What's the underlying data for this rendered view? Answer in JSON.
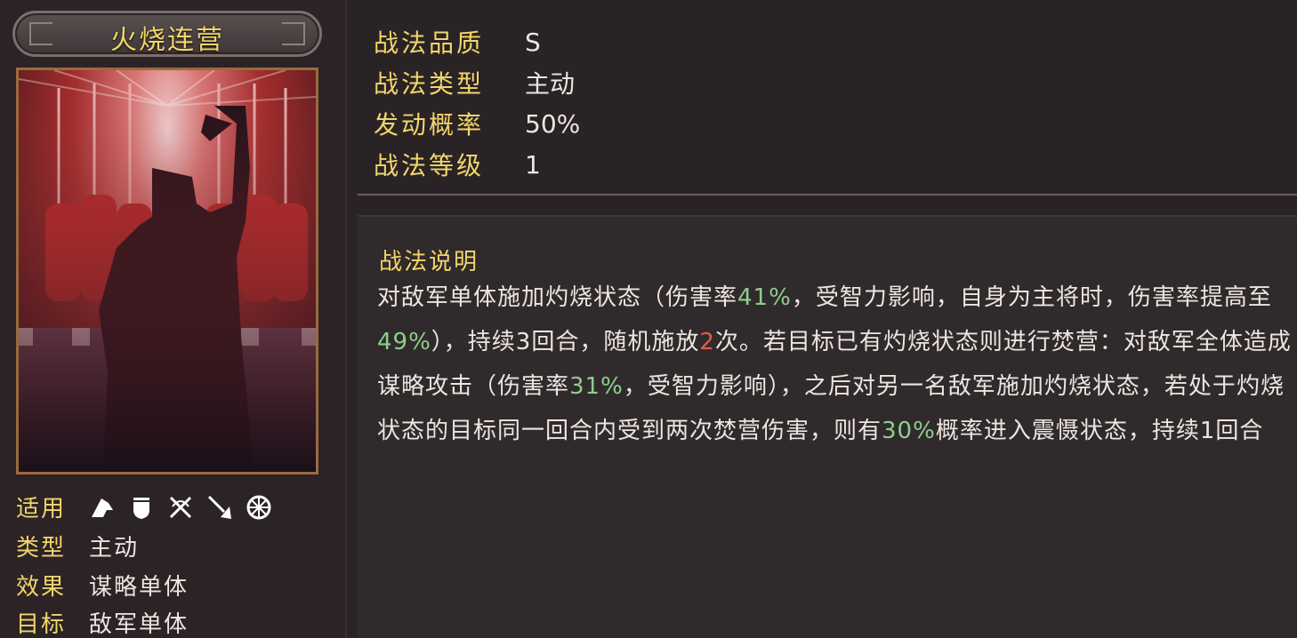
{
  "skill": {
    "name": "火烧连营"
  },
  "sidebar": {
    "applicable_label": "适用",
    "applicable_icons": [
      "cavalry-icon",
      "shield-icon",
      "crossbow-icon",
      "spear-icon",
      "wheel-icon"
    ],
    "type_label": "类型",
    "type_value": "主动",
    "effect_label": "效果",
    "effect_value": "谋略单体",
    "target_label": "目标",
    "target_value": "敌军单体"
  },
  "stats": {
    "quality_label": "战法品质",
    "quality_value": "S",
    "type_label": "战法类型",
    "type_value": "主动",
    "rate_label": "发动概率",
    "rate_value": "50%",
    "level_label": "战法等级",
    "level_value": "1"
  },
  "description": {
    "title": "战法说明",
    "parts": {
      "p1": "对敌军单体施加灼烧状态（伤害率",
      "p2": "41%",
      "p3": "，受智力影响，自身为主将时，伤害率提高至",
      "p4": "49%",
      "p5": "），持续3回合，随机施放",
      "p6": "2",
      "p7": "次。若目标已有灼烧状态则进行焚营：对敌军全体造成谋略攻击（伤害率",
      "p8": "31%",
      "p9": "，受智力影响），之后对另一名敌军施加灼烧状态，若处于灼烧状态的目标同一回合内受到两次焚营伤害，则有",
      "p10": "30%",
      "p11": "概率进入震慑状态，持续1回合"
    }
  },
  "colors": {
    "gold": "#f2d66a",
    "highlight_green": "#8bd08b",
    "highlight_red": "#e35a4e"
  }
}
